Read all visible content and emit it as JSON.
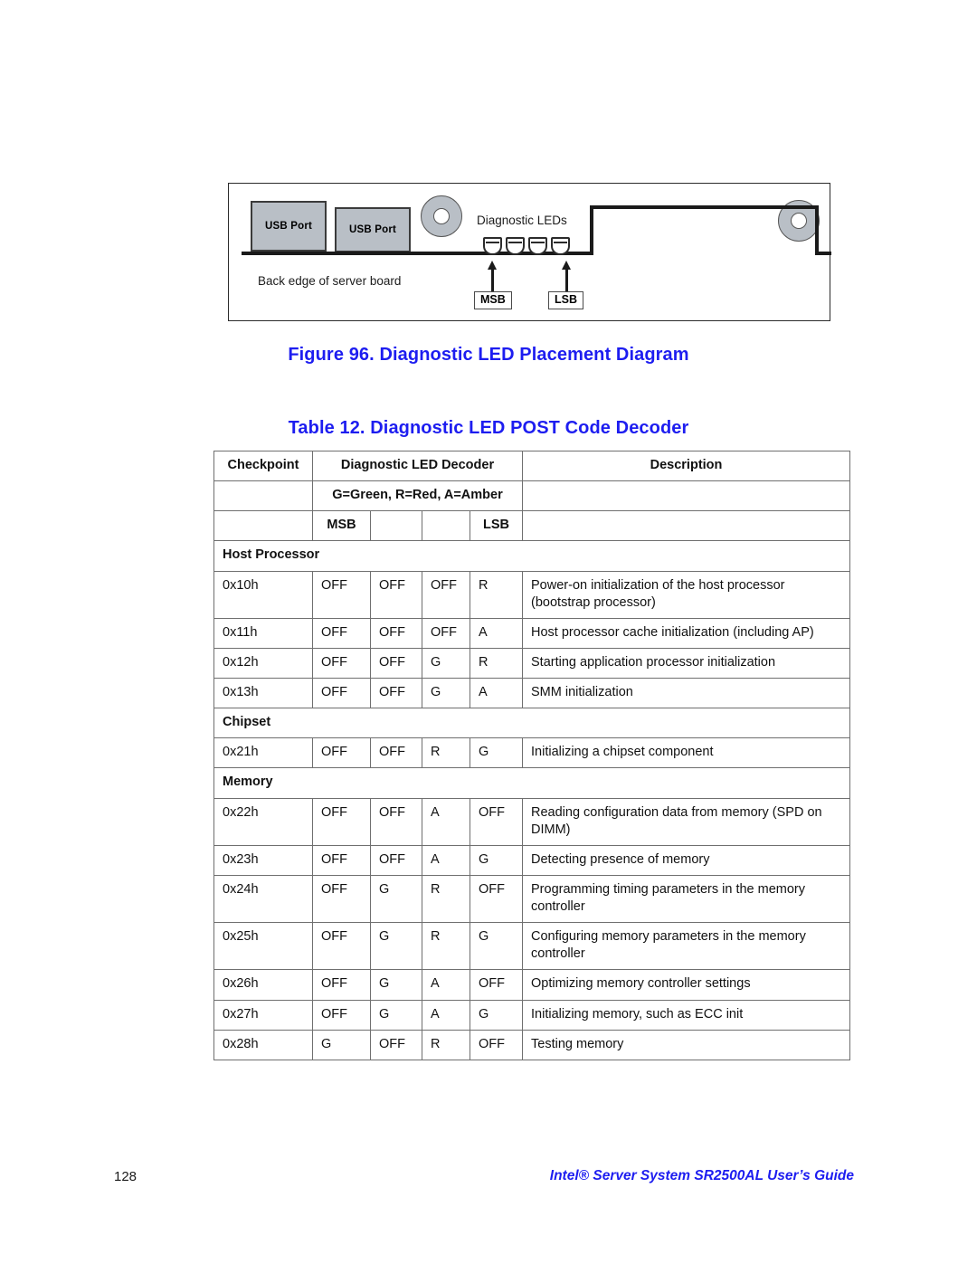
{
  "figure": {
    "usb_port_1": "USB Port",
    "usb_port_2": "USB Port",
    "diagnostic_leds_label": "Diagnostic LEDs",
    "back_edge_label": "Back edge of server board",
    "msb_label": "MSB",
    "lsb_label": "LSB",
    "caption": "Figure 96. Diagnostic LED Placement Diagram",
    "colors": {
      "port_fill": "#b9bfc6",
      "outline": "#2b2b2b",
      "caption_blue": "#1d1df0"
    }
  },
  "table": {
    "caption": "Table 12. Diagnostic LED POST Code Decoder",
    "headers": {
      "checkpoint": "Checkpoint",
      "decoder": "Diagnostic LED Decoder",
      "description": "Description",
      "legend": "G=Green, R=Red, A=Amber",
      "msb": "MSB",
      "lsb": "LSB"
    },
    "sections": [
      {
        "title": "Host Processor",
        "rows": [
          {
            "checkpoint": "0x10h",
            "led1": "OFF",
            "led2": "OFF",
            "led3": "OFF",
            "led4": "R",
            "description": "Power-on initialization of the host processor (bootstrap processor)"
          },
          {
            "checkpoint": "0x11h",
            "led1": "OFF",
            "led2": "OFF",
            "led3": "OFF",
            "led4": "A",
            "description": "Host processor cache initialization (including AP)"
          },
          {
            "checkpoint": "0x12h",
            "led1": "OFF",
            "led2": "OFF",
            "led3": "G",
            "led4": "R",
            "description": "Starting application processor initialization"
          },
          {
            "checkpoint": "0x13h",
            "led1": "OFF",
            "led2": "OFF",
            "led3": "G",
            "led4": "A",
            "description": "SMM initialization"
          }
        ]
      },
      {
        "title": "Chipset",
        "rows": [
          {
            "checkpoint": "0x21h",
            "led1": "OFF",
            "led2": "OFF",
            "led3": "R",
            "led4": "G",
            "description": "Initializing a chipset component"
          }
        ]
      },
      {
        "title": "Memory",
        "rows": [
          {
            "checkpoint": "0x22h",
            "led1": "OFF",
            "led2": "OFF",
            "led3": "A",
            "led4": "OFF",
            "description": "Reading configuration data from memory (SPD on DIMM)"
          },
          {
            "checkpoint": "0x23h",
            "led1": "OFF",
            "led2": "OFF",
            "led3": "A",
            "led4": "G",
            "description": "Detecting presence of memory"
          },
          {
            "checkpoint": "0x24h",
            "led1": "OFF",
            "led2": "G",
            "led3": "R",
            "led4": "OFF",
            "description": "Programming timing parameters in the memory controller"
          },
          {
            "checkpoint": "0x25h",
            "led1": "OFF",
            "led2": "G",
            "led3": "R",
            "led4": "G",
            "description": "Configuring memory parameters in the memory controller"
          },
          {
            "checkpoint": "0x26h",
            "led1": "OFF",
            "led2": "G",
            "led3": "A",
            "led4": "OFF",
            "description": "Optimizing memory controller settings"
          },
          {
            "checkpoint": "0x27h",
            "led1": "OFF",
            "led2": "G",
            "led3": "A",
            "led4": "G",
            "description": "Initializing memory, such as ECC init"
          },
          {
            "checkpoint": "0x28h",
            "led1": "G",
            "led2": "OFF",
            "led3": "R",
            "led4": "OFF",
            "description": "Testing memory"
          }
        ]
      }
    ]
  },
  "footer": {
    "page_number": "128",
    "guide_title": "Intel® Server System SR2500AL User’s Guide"
  }
}
